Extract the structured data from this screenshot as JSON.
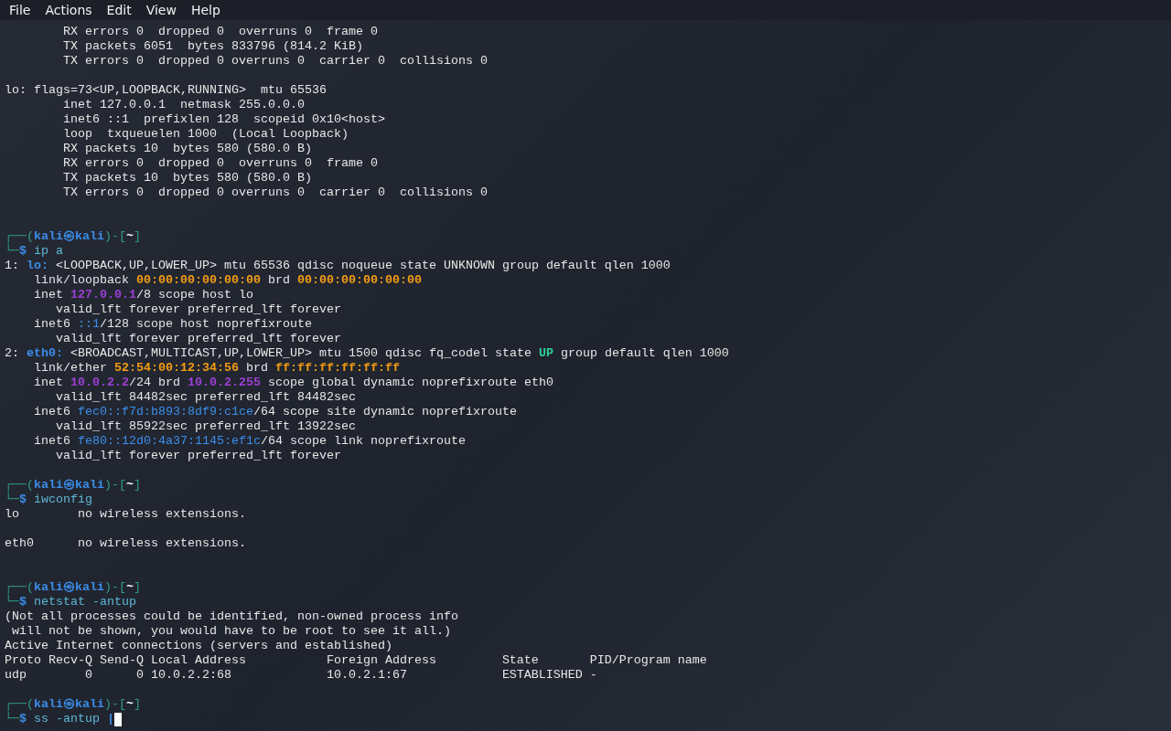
{
  "menu": [
    "File",
    "Actions",
    "Edit",
    "View",
    "Help"
  ],
  "lines": [
    {
      "kind": "text",
      "segs": [
        {
          "t": "        RX errors 0  dropped 0  overruns 0  frame 0",
          "kind": "plain"
        }
      ]
    },
    {
      "kind": "text",
      "segs": [
        {
          "t": "        TX packets 6051  bytes 833796 (814.2 KiB)",
          "kind": "plain"
        }
      ]
    },
    {
      "kind": "text",
      "segs": [
        {
          "t": "        TX errors 0  dropped 0 overruns 0  carrier 0  collisions 0",
          "kind": "plain"
        }
      ]
    },
    {
      "kind": "blank"
    },
    {
      "kind": "text",
      "segs": [
        {
          "t": "lo: flags=73<UP,LOOPBACK,RUNNING>  mtu 65536",
          "kind": "plain"
        }
      ]
    },
    {
      "kind": "text",
      "segs": [
        {
          "t": "        inet 127.0.0.1  netmask 255.0.0.0",
          "kind": "plain"
        }
      ]
    },
    {
      "kind": "text",
      "segs": [
        {
          "t": "        inet6 ::1  prefixlen 128  scopeid 0x10<host>",
          "kind": "plain"
        }
      ]
    },
    {
      "kind": "text",
      "segs": [
        {
          "t": "        loop  txqueuelen 1000  (Local Loopback)",
          "kind": "plain"
        }
      ]
    },
    {
      "kind": "text",
      "segs": [
        {
          "t": "        RX packets 10  bytes 580 (580.0 B)",
          "kind": "plain"
        }
      ]
    },
    {
      "kind": "text",
      "segs": [
        {
          "t": "        RX errors 0  dropped 0  overruns 0  frame 0",
          "kind": "plain"
        }
      ]
    },
    {
      "kind": "text",
      "segs": [
        {
          "t": "        TX packets 10  bytes 580 (580.0 B)",
          "kind": "plain"
        }
      ]
    },
    {
      "kind": "text",
      "segs": [
        {
          "t": "        TX errors 0  dropped 0 overruns 0  carrier 0  collisions 0",
          "kind": "plain"
        }
      ]
    },
    {
      "kind": "blank"
    },
    {
      "kind": "blank"
    },
    {
      "kind": "text",
      "segs": [
        {
          "t": "┌──(",
          "kind": "frame"
        },
        {
          "t": "kali㉿kali",
          "kind": "user"
        },
        {
          "t": ")-[",
          "kind": "frame"
        },
        {
          "t": "~",
          "kind": "dir"
        },
        {
          "t": "]",
          "kind": "frame"
        }
      ]
    },
    {
      "kind": "text",
      "segs": [
        {
          "t": "└─",
          "kind": "frame"
        },
        {
          "t": "$",
          "kind": "dollar"
        },
        {
          "t": " ip a",
          "kind": "cmd"
        }
      ]
    },
    {
      "kind": "text",
      "segs": [
        {
          "t": "1: ",
          "kind": "plain"
        },
        {
          "t": "lo:",
          "kind": "iface"
        },
        {
          "t": " <LOOPBACK,UP,LOWER_UP> mtu 65536 qdisc noqueue state UNKNOWN group default qlen 1000",
          "kind": "plain"
        }
      ]
    },
    {
      "kind": "text",
      "segs": [
        {
          "t": "    link/loopback ",
          "kind": "plain"
        },
        {
          "t": "00:00:00:00:00:00",
          "kind": "mac"
        },
        {
          "t": " brd ",
          "kind": "plain"
        },
        {
          "t": "00:00:00:00:00:00",
          "kind": "mac"
        }
      ]
    },
    {
      "kind": "text",
      "segs": [
        {
          "t": "    inet ",
          "kind": "plain"
        },
        {
          "t": "127.0.0.1",
          "kind": "ipv4"
        },
        {
          "t": "/8 scope host lo",
          "kind": "plain"
        }
      ]
    },
    {
      "kind": "text",
      "segs": [
        {
          "t": "       valid_lft forever preferred_lft forever",
          "kind": "plain"
        }
      ]
    },
    {
      "kind": "text",
      "segs": [
        {
          "t": "    inet6 ",
          "kind": "plain"
        },
        {
          "t": "::1",
          "kind": "ipv6"
        },
        {
          "t": "/128 scope host noprefixroute",
          "kind": "plain"
        }
      ]
    },
    {
      "kind": "text",
      "segs": [
        {
          "t": "       valid_lft forever preferred_lft forever",
          "kind": "plain"
        }
      ]
    },
    {
      "kind": "text",
      "segs": [
        {
          "t": "2: ",
          "kind": "plain"
        },
        {
          "t": "eth0:",
          "kind": "iface"
        },
        {
          "t": " <BROADCAST,MULTICAST,UP,LOWER_UP> mtu 1500 qdisc fq_codel state ",
          "kind": "plain"
        },
        {
          "t": "UP",
          "kind": "up"
        },
        {
          "t": " group default qlen 1000",
          "kind": "plain"
        }
      ]
    },
    {
      "kind": "text",
      "segs": [
        {
          "t": "    link/ether ",
          "kind": "plain"
        },
        {
          "t": "52:54:00:12:34:56",
          "kind": "mac"
        },
        {
          "t": " brd ",
          "kind": "plain"
        },
        {
          "t": "ff:ff:ff:ff:ff:ff",
          "kind": "mac"
        }
      ]
    },
    {
      "kind": "text",
      "segs": [
        {
          "t": "    inet ",
          "kind": "plain"
        },
        {
          "t": "10.0.2.2",
          "kind": "ipv4"
        },
        {
          "t": "/24 brd ",
          "kind": "plain"
        },
        {
          "t": "10.0.2.255",
          "kind": "ipv4"
        },
        {
          "t": " scope global dynamic noprefixroute eth0",
          "kind": "plain"
        }
      ]
    },
    {
      "kind": "text",
      "segs": [
        {
          "t": "       valid_lft 84482sec preferred_lft 84482sec",
          "kind": "plain"
        }
      ]
    },
    {
      "kind": "text",
      "segs": [
        {
          "t": "    inet6 ",
          "kind": "plain"
        },
        {
          "t": "fec0::f7d:b893:8df9:c1ce",
          "kind": "ipv6"
        },
        {
          "t": "/64 scope site dynamic noprefixroute",
          "kind": "plain"
        }
      ]
    },
    {
      "kind": "text",
      "segs": [
        {
          "t": "       valid_lft 85922sec preferred_lft 13922sec",
          "kind": "plain"
        }
      ]
    },
    {
      "kind": "text",
      "segs": [
        {
          "t": "    inet6 ",
          "kind": "plain"
        },
        {
          "t": "fe80::12d0:4a37:1145:ef1c",
          "kind": "ipv6"
        },
        {
          "t": "/64 scope link noprefixroute",
          "kind": "plain"
        }
      ]
    },
    {
      "kind": "text",
      "segs": [
        {
          "t": "       valid_lft forever preferred_lft forever",
          "kind": "plain"
        }
      ]
    },
    {
      "kind": "blank"
    },
    {
      "kind": "text",
      "segs": [
        {
          "t": "┌──(",
          "kind": "frame"
        },
        {
          "t": "kali㉿kali",
          "kind": "user"
        },
        {
          "t": ")-[",
          "kind": "frame"
        },
        {
          "t": "~",
          "kind": "dir"
        },
        {
          "t": "]",
          "kind": "frame"
        }
      ]
    },
    {
      "kind": "text",
      "segs": [
        {
          "t": "└─",
          "kind": "frame"
        },
        {
          "t": "$",
          "kind": "dollar"
        },
        {
          "t": " iwconfig",
          "kind": "cmd"
        }
      ]
    },
    {
      "kind": "text",
      "segs": [
        {
          "t": "lo        no wireless extensions.",
          "kind": "plain"
        }
      ]
    },
    {
      "kind": "blank"
    },
    {
      "kind": "text",
      "segs": [
        {
          "t": "eth0      no wireless extensions.",
          "kind": "plain"
        }
      ]
    },
    {
      "kind": "blank"
    },
    {
      "kind": "blank"
    },
    {
      "kind": "text",
      "segs": [
        {
          "t": "┌──(",
          "kind": "frame"
        },
        {
          "t": "kali㉿kali",
          "kind": "user"
        },
        {
          "t": ")-[",
          "kind": "frame"
        },
        {
          "t": "~",
          "kind": "dir"
        },
        {
          "t": "]",
          "kind": "frame"
        }
      ]
    },
    {
      "kind": "text",
      "segs": [
        {
          "t": "└─",
          "kind": "frame"
        },
        {
          "t": "$",
          "kind": "dollar"
        },
        {
          "t": " netstat -antup",
          "kind": "cmd"
        }
      ]
    },
    {
      "kind": "text",
      "segs": [
        {
          "t": "(Not all processes could be identified, non-owned process info",
          "kind": "plain"
        }
      ]
    },
    {
      "kind": "text",
      "segs": [
        {
          "t": " will not be shown, you would have to be root to see it all.)",
          "kind": "plain"
        }
      ]
    },
    {
      "kind": "text",
      "segs": [
        {
          "t": "Active Internet connections (servers and established)",
          "kind": "plain"
        }
      ]
    },
    {
      "kind": "text",
      "segs": [
        {
          "t": "Proto Recv-Q Send-Q Local Address           Foreign Address         State       PID/Program name",
          "kind": "plain"
        }
      ]
    },
    {
      "kind": "text",
      "segs": [
        {
          "t": "udp        0      0 10.0.2.2:68             10.0.2.1:67             ESTABLISHED -",
          "kind": "plain"
        }
      ]
    },
    {
      "kind": "blank"
    },
    {
      "kind": "text",
      "segs": [
        {
          "t": "┌──(",
          "kind": "frame"
        },
        {
          "t": "kali㉿kali",
          "kind": "user"
        },
        {
          "t": ")-[",
          "kind": "frame"
        },
        {
          "t": "~",
          "kind": "dir"
        },
        {
          "t": "]",
          "kind": "frame"
        }
      ]
    },
    {
      "kind": "text",
      "cursor": true,
      "segs": [
        {
          "t": "└─",
          "kind": "frame"
        },
        {
          "t": "$",
          "kind": "dollar"
        },
        {
          "t": " ss -antup ",
          "kind": "cmd"
        },
        {
          "t": "|",
          "kind": "dollar"
        }
      ]
    }
  ]
}
